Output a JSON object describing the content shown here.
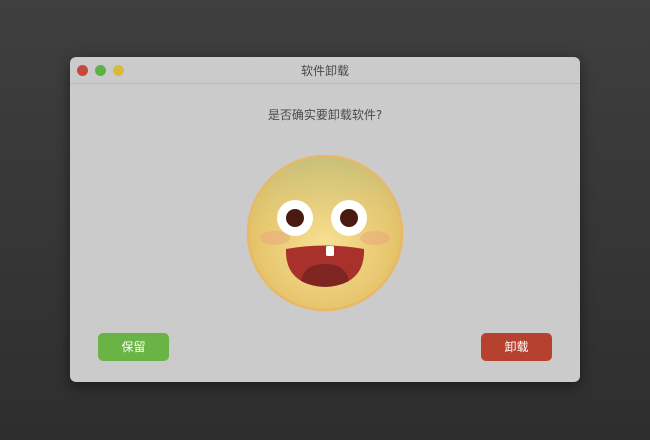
{
  "window": {
    "title": "软件卸载",
    "controls": [
      "close",
      "minimize",
      "maximize"
    ]
  },
  "dialog": {
    "question": "是否确实要卸载软件?",
    "illustration": "laughing-face-emoji"
  },
  "buttons": {
    "keep_label": "保留",
    "uninstall_label": "卸载"
  },
  "colors": {
    "keep_button": "#6ab345",
    "uninstall_button": "#b7412f",
    "close_dot": "#c8463a",
    "minimize_dot": "#5db247",
    "maximize_dot": "#d8bb3a"
  }
}
